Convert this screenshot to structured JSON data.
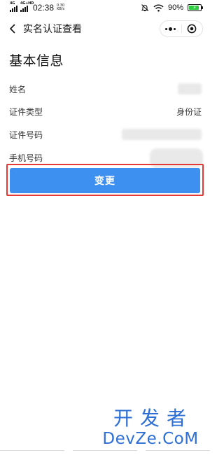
{
  "status_bar": {
    "net1": "4G",
    "net2": "4G+HD",
    "time": "02:38",
    "speed_value": "0.30",
    "speed_unit": "KB/s",
    "battery_pct": "90%",
    "battery_level": 0.9,
    "icons": [
      "signal-icon",
      "signal-icon",
      "mute-bell-icon",
      "wifi-icon",
      "battery-icon"
    ]
  },
  "nav": {
    "title": "实名认证查看",
    "back_icon": "chevron-left-icon",
    "more_icon": "more-dots-icon",
    "close_icon": "target-circle-icon"
  },
  "section": {
    "title": "基本信息"
  },
  "info_rows": [
    {
      "label": "姓名",
      "value": ""
    },
    {
      "label": "证件类型",
      "value": "身份证"
    },
    {
      "label": "证件号码",
      "value": ""
    },
    {
      "label": "手机号码",
      "value": ""
    }
  ],
  "actions": {
    "change_label": "变更"
  },
  "watermark": {
    "cn": "开发者",
    "en": "DevZe.CoM"
  },
  "colors": {
    "primary": "#3d8ff0",
    "highlight_border": "#e53935",
    "watermark": "#2d6fd6"
  }
}
